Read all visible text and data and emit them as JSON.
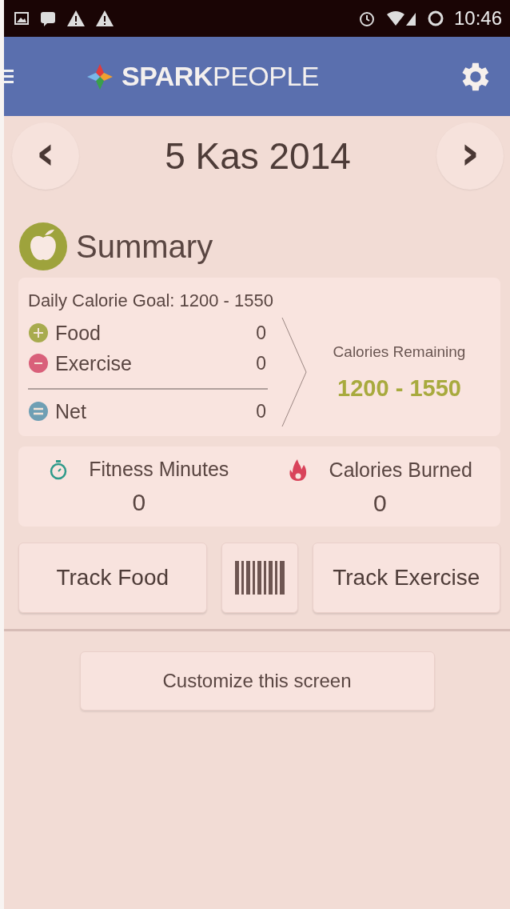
{
  "status_bar": {
    "time": "10:46"
  },
  "header": {
    "logo": "**SPARK**PEOPLE"
  },
  "date_nav": {
    "date": "5 Kas 2014",
    "prev": "‹",
    "next": "›"
  },
  "summary": {
    "title": "Summary",
    "goal": "Daily Calorie Goal: 1200 - 1550",
    "lines": [
      {
        "kind": "plus",
        "label": "Food",
        "value": "0",
        "color": "#a8ab4e"
      },
      {
        "kind": "minus",
        "label": "Exercise",
        "value": "0",
        "color": "#d9607a"
      },
      {
        "kind": "equals",
        "label": "Net",
        "value": "0",
        "color": "#6f9fb4"
      }
    ],
    "remaining_label": "Calories Remaining",
    "remaining_value": "1200 - 1550"
  },
  "stats": [
    {
      "kind": "stopwatch",
      "label": "Fitness Minutes",
      "value": "0"
    },
    {
      "kind": "flame",
      "label": "Calories Burned",
      "value": "0"
    }
  ],
  "actions": {
    "track_food": "Track Food",
    "track_exercise": "Track Exercise"
  },
  "customize": "Customize this screen"
}
